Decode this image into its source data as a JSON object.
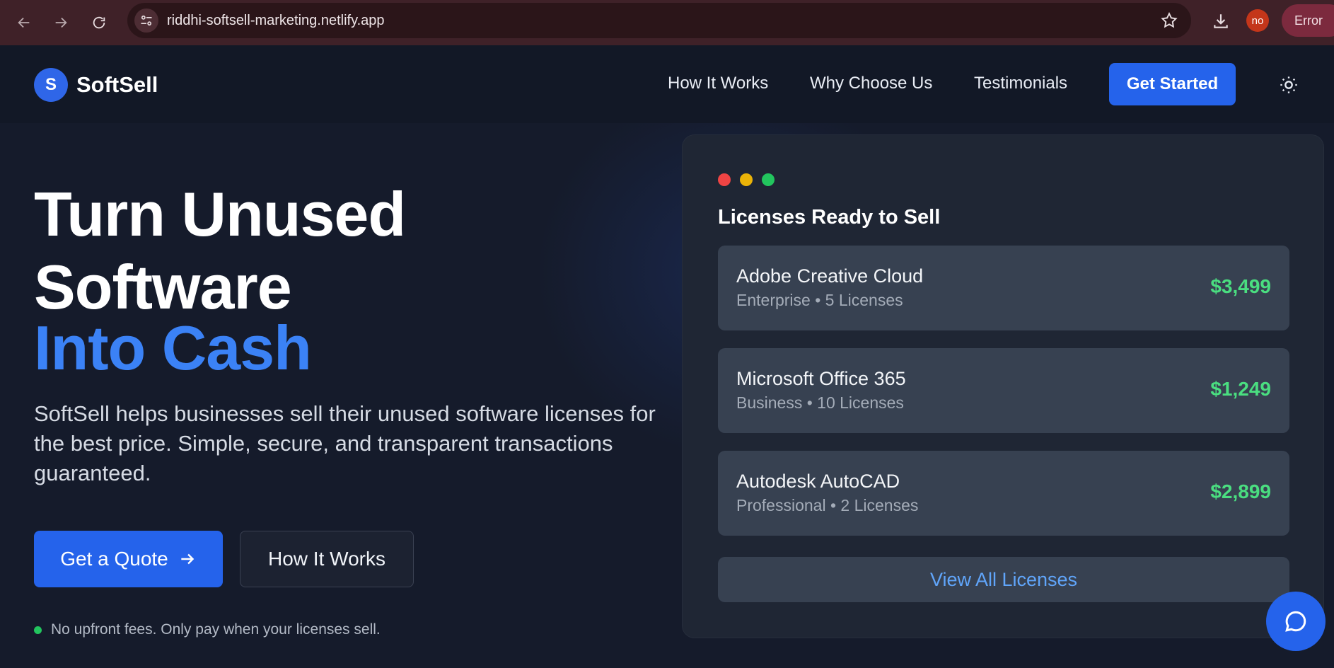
{
  "browser": {
    "url": "riddhi-softsell-marketing.netlify.app",
    "profile_initials": "no",
    "error_label": "Error",
    "icons": [
      "back-arrow-icon",
      "forward-arrow-icon",
      "reload-icon",
      "site-info-icon",
      "star-icon",
      "download-icon"
    ]
  },
  "header": {
    "logo_letter": "S",
    "brand": "SoftSell",
    "nav": [
      "How It Works",
      "Why Choose Us",
      "Testimonials"
    ],
    "cta": "Get Started"
  },
  "hero": {
    "line1": "Turn Unused",
    "line2": "Software",
    "line3": "Into Cash",
    "description": "SoftSell helps businesses sell their unused software licenses for the best price. Simple, secure, and transparent transactions guaranteed.",
    "primary_button": "Get a Quote",
    "secondary_button": "How It Works",
    "note": "No upfront fees. Only pay when your licenses sell."
  },
  "panel": {
    "title": "Licenses Ready to Sell",
    "licenses": [
      {
        "name": "Adobe Creative Cloud",
        "meta": "Enterprise • 5 Licenses",
        "price": "$3,499"
      },
      {
        "name": "Microsoft Office 365",
        "meta": "Business • 10 Licenses",
        "price": "$1,249"
      },
      {
        "name": "Autodesk AutoCAD",
        "meta": "Professional • 2 Licenses",
        "price": "$2,899"
      }
    ],
    "view_all": "View All Licenses"
  },
  "colors": {
    "accent": "#2563eb",
    "accent_text": "#3b82f6",
    "price_green": "#4ade80",
    "window_dots": [
      "#ef4444",
      "#eab308",
      "#22c55e"
    ],
    "chrome_bg": "#3f2128",
    "page_bg": "#151b2b"
  }
}
